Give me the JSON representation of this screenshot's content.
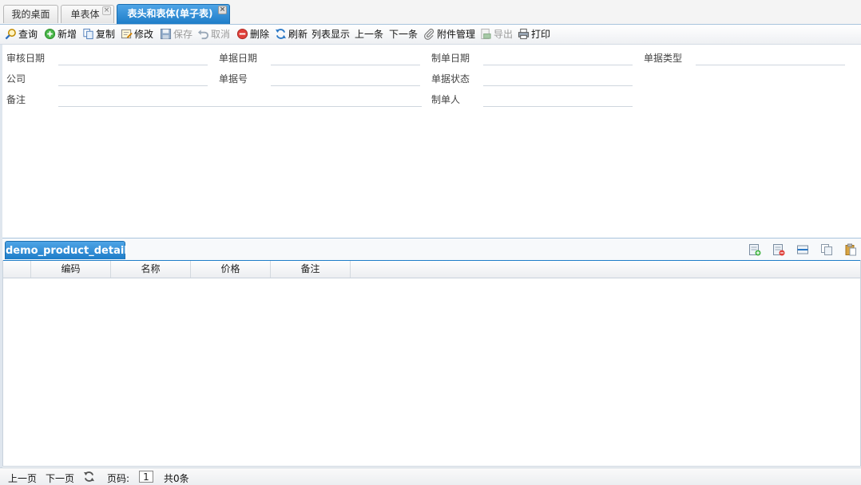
{
  "tabs": [
    {
      "label": "我的桌面"
    },
    {
      "label": "单表体",
      "close": "×"
    },
    {
      "label": "表头和表体(单子表)",
      "close": "×"
    }
  ],
  "toolbar": {
    "query": "查询",
    "add": "新增",
    "copy": "复制",
    "edit": "修改",
    "save": "保存",
    "cancel": "取消",
    "delete": "删除",
    "refresh": "刷新",
    "list_view": "列表显示",
    "prev": "上一条",
    "next": "下一条",
    "attachments": "附件管理",
    "export": "导出",
    "print": "打印"
  },
  "form": {
    "audit_date": {
      "label": "审核日期",
      "value": ""
    },
    "doc_date": {
      "label": "单据日期",
      "value": ""
    },
    "create_date": {
      "label": "制单日期",
      "value": ""
    },
    "doc_type": {
      "label": "单据类型",
      "value": ""
    },
    "company": {
      "label": "公司",
      "value": ""
    },
    "doc_no": {
      "label": "单据号",
      "value": ""
    },
    "doc_status": {
      "label": "单据状态",
      "value": ""
    },
    "remark": {
      "label": "备注",
      "value": ""
    },
    "creator": {
      "label": "制单人",
      "value": ""
    }
  },
  "detail": {
    "tab_label": "demo_product_detail",
    "columns": [
      "编码",
      "名称",
      "价格",
      "备注"
    ],
    "rows": []
  },
  "pager": {
    "prev_page": "上一页",
    "next_page": "下一页",
    "page_label": "页码:",
    "page_number": "1",
    "total": "共0条"
  }
}
